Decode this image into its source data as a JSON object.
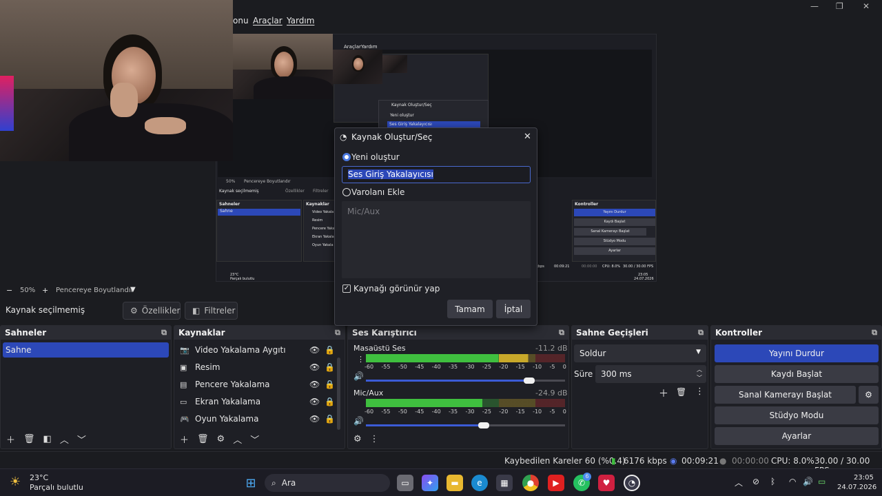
{
  "menu": {
    "items": [
      "onu",
      "Araçlar",
      "Yardım"
    ]
  },
  "window_controls": {
    "minimize": "—",
    "maximize": "❐",
    "close": "✕"
  },
  "nested_preview": {
    "menu": [
      "onu",
      "Araçlar",
      "Yardım"
    ],
    "dialog_title": "Kaynak Oluştur/Seç",
    "dialog_option": "Yeni oluştur",
    "dialog_input": "Ses Giriş Yakalayıcısı",
    "zoom": "50%",
    "zoom_mode": "Pencereye Boyutlandır",
    "no_source": "Kaynak seçilmemiş",
    "props": "Özellikler",
    "filters": "Filtreler",
    "scenes_title": "Sahneler",
    "scene": "Sahne",
    "sources_title": "Kaynaklar",
    "sources": [
      "Video Yakala",
      "Resim",
      "Pencere Yaka",
      "Ekran Yakala",
      "Oyun Yakala"
    ],
    "controls_title": "Kontroller",
    "controls": [
      "Yayını Durdur",
      "Kaydı Başlat",
      "Sanal Kamerayı Başlat",
      "Stüdyo Modu",
      "Ayarlar"
    ],
    "status_kbps": "kbps",
    "status_time": "00:09:21",
    "status_rec": "00:00:00",
    "status_cpu": "CPU: 8.0%",
    "status_fps": "30.00 / 30.00 FPS",
    "weather_temp": "23°C",
    "weather_desc": "Parçalı bulutlu",
    "clock_time": "23:05",
    "clock_date": "24.07.2026"
  },
  "zoom": {
    "minus": "−",
    "value": "50%",
    "plus": "+",
    "mode": "Pencereye Boyutlandır"
  },
  "context": {
    "no_source": "Kaynak seçilmemiş",
    "properties": "Özellikler",
    "filters": "Filtreler"
  },
  "scenes": {
    "title": "Sahneler",
    "items": [
      "Sahne"
    ]
  },
  "sources": {
    "title": "Kaynaklar",
    "items": [
      {
        "label": "Video Yakalama Aygıtı",
        "icon": "camera-icon"
      },
      {
        "label": "Resim",
        "icon": "image-icon"
      },
      {
        "label": "Pencere Yakalama",
        "icon": "window-icon"
      },
      {
        "label": "Ekran Yakalama",
        "icon": "monitor-icon"
      },
      {
        "label": "Oyun Yakalama",
        "icon": "gamepad-icon"
      }
    ]
  },
  "mixer": {
    "title": "Ses Karıştırıcı",
    "channels": [
      {
        "name": "Masaüstü Ses",
        "db": "-11.2 dB",
        "level_db": -11.2,
        "volume": 0.82
      },
      {
        "name": "Mic/Aux",
        "db": "-24.9 dB",
        "level_db": -24.9,
        "volume": 0.59
      }
    ],
    "ticks": [
      "-60",
      "-55",
      "-50",
      "-45",
      "-40",
      "-35",
      "-30",
      "-25",
      "-20",
      "-15",
      "-10",
      "-5",
      "0"
    ]
  },
  "transitions": {
    "title": "Sahne Geçişleri",
    "selected": "Soldur",
    "duration_label": "Süre",
    "duration": "300 ms"
  },
  "controls": {
    "title": "Kontroller",
    "stream": "Yayını Durdur",
    "record": "Kaydı Başlat",
    "virtual_cam": "Sanal Kamerayı Başlat",
    "studio": "Stüdyo Modu",
    "settings": "Ayarlar"
  },
  "status": {
    "dropped": "Kaybedilen Kareler 60 (%0.4)",
    "kbps": "6176 kbps",
    "stream_time": "00:09:21",
    "rec_time": "00:00:00",
    "cpu": "CPU: 8.0%",
    "fps": "30.00 / 30.00 FPS"
  },
  "dialog": {
    "title": "Kaynak Oluştur/Seç",
    "create_new": "Yeni oluştur",
    "name_value": "Ses Giriş Yakalayıcısı",
    "add_existing": "Varolanı Ekle",
    "existing_items": [
      "Mic/Aux"
    ],
    "visible_label": "Kaynağı görünür yap",
    "ok": "Tamam",
    "cancel": "İptal"
  },
  "taskbar": {
    "weather_temp": "23°C",
    "weather_desc": "Parçalı bulutlu",
    "search": "Ara",
    "time": "23:05",
    "date": "24.07.2026",
    "whatsapp_badge": "6"
  },
  "colors": {
    "accent": "#2c48b8",
    "meter_green": "#3fbf3f",
    "meter_yellow": "#c8a82a",
    "meter_red": "#c03030"
  }
}
